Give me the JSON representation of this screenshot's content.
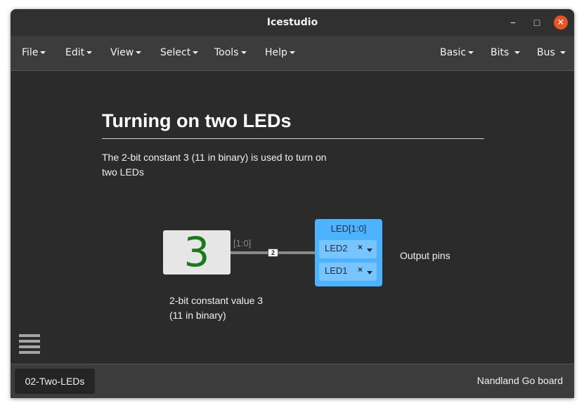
{
  "window": {
    "title": "Icestudio",
    "minimize_glyph": "−",
    "maximize_glyph": "□",
    "close_glyph": "✕",
    "close_color": "#e95420"
  },
  "menu": {
    "left": [
      "File",
      "Edit",
      "View",
      "Select",
      "Tools",
      "Help"
    ],
    "right": [
      "Basic",
      "Bits",
      "Bus"
    ]
  },
  "canvas": {
    "heading": "Turning on two LEDs",
    "description": "The 2-bit constant 3 (11 in binary) is used to turn on two LEDs",
    "constant_value": "3",
    "constant_color": "#1a7a1a",
    "wire_range": "[1:0]",
    "wire_width": "2",
    "led_block": {
      "title": "LED[1:0]",
      "pins": [
        {
          "name": "LED2",
          "clear": "×"
        },
        {
          "name": "LED1",
          "clear": "×"
        }
      ],
      "color": "#4db3ff"
    },
    "output_label": "Output pins",
    "constant_caption_line1": "2-bit constant value 3",
    "constant_caption_line2": "(11 in binary)",
    "menu_icon": "hamburger-icon"
  },
  "footer": {
    "active_tab": "02-Two-LEDs",
    "board": "Nandland Go board"
  }
}
